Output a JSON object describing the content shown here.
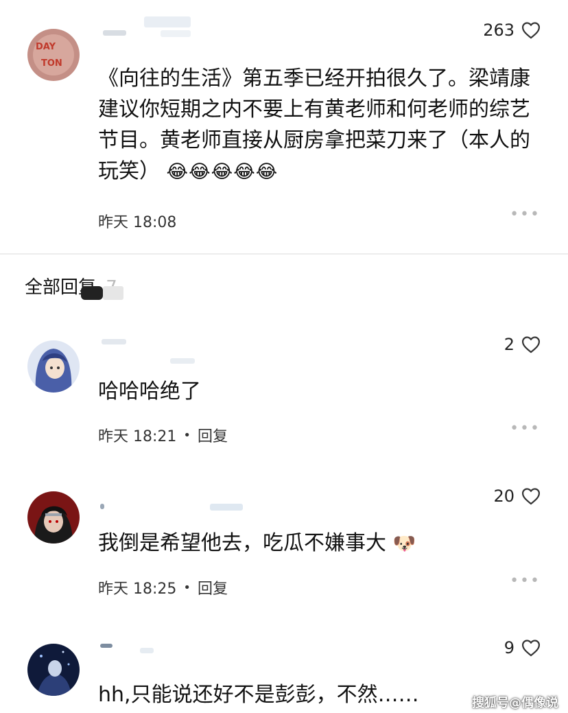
{
  "main_comment": {
    "likes": "263",
    "text": "《向往的生活》第五季已经开拍很久了。梁靖康建议你短期之内不要上有黄老师和何老师的综艺节目。黄老师直接从厨房拿把菜刀来了（本人的玩笑）",
    "emojis": "😂😂😂😂😂",
    "time": "昨天 18:08",
    "more": "•••",
    "avatar_text": "DAY TON"
  },
  "replies_header": {
    "label": "全部回复",
    "count": "7"
  },
  "replies": [
    {
      "likes": "2",
      "text": "哈哈哈绝了",
      "emoji": "",
      "time": "昨天 18:21",
      "dot": "•",
      "reply_label": "回复",
      "more": "•••"
    },
    {
      "likes": "20",
      "text": "我倒是希望他去，吃瓜不嫌事大",
      "emoji": "🐶",
      "time": "昨天 18:25",
      "dot": "•",
      "reply_label": "回复",
      "more": "•••"
    },
    {
      "likes": "9",
      "text": "hh,只能说还好不是彭彭，不然……",
      "emoji": ""
    }
  ],
  "watermark": "搜狐号@偶像说",
  "colors": {
    "text": "#111111",
    "muted": "#333333",
    "divider": "#ececec",
    "dots": "#b8b8b8"
  },
  "icons": {
    "like": "heart-outline-icon",
    "more": "more-dots-icon"
  }
}
